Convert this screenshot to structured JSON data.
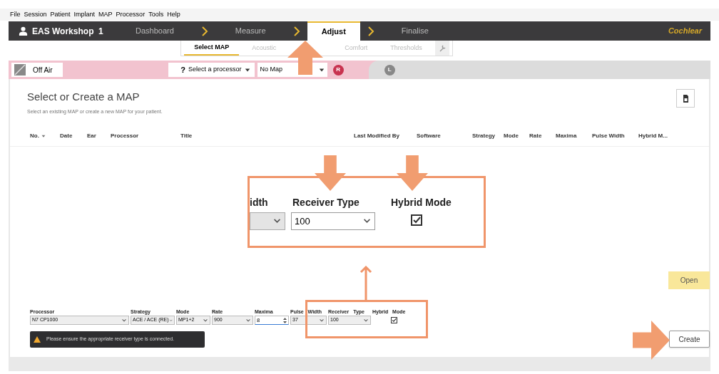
{
  "menu": [
    "File",
    "Session",
    "Patient",
    "Implant",
    "MAP",
    "Processor",
    "Tools",
    "Help"
  ],
  "nav": {
    "user": "EAS Workshop  1",
    "brand": "Cochlear",
    "steps": [
      {
        "label": "Dashboard",
        "selected": false
      },
      {
        "label": "Measure",
        "selected": false
      },
      {
        "label": "Adjust",
        "selected": true
      },
      {
        "label": "Finalise",
        "selected": false
      }
    ]
  },
  "subtabs": [
    {
      "label": "Select MAP",
      "selected": true
    },
    {
      "label": "Acoustic",
      "selected": false
    },
    {
      "label": "Comfort",
      "selected": false
    },
    {
      "label": "Thresholds",
      "selected": false
    }
  ],
  "status_bar": {
    "connection": "Off Air",
    "help_mark": "?",
    "processor_select": "Select a processor",
    "map_select": "No Map",
    "ears": [
      {
        "label": "R",
        "selected": true
      },
      {
        "label": "L",
        "selected": false
      }
    ]
  },
  "main": {
    "title": "Select or Create a MAP",
    "subtitle": "Select an existing MAP or create a new MAP for your patient.",
    "columns": [
      "No.",
      "Date",
      "Ear",
      "Processor",
      "Title",
      "Last Modified By",
      "Software",
      "Strategy",
      "Mode",
      "Rate",
      "Maxima",
      "Pulse Width",
      "Hybrid M..."
    ]
  },
  "callout": {
    "labels": [
      "idth",
      "Receiver Type",
      "Hybrid Mode"
    ],
    "receiver_value": "100",
    "hybrid_checked": true
  },
  "form": {
    "fields": [
      {
        "kind": "select",
        "label": "Processor",
        "value": "N7 CP1000"
      },
      {
        "kind": "select",
        "label": "Strategy",
        "value": "ACE / ACE (RE)"
      },
      {
        "kind": "select",
        "label": "Mode",
        "value": "MP1+2"
      },
      {
        "kind": "select",
        "label": "Rate",
        "value": "900"
      },
      {
        "kind": "spin",
        "label": "Maxima",
        "value": "8"
      },
      {
        "kind": "select",
        "label": "Pulse Width",
        "value": "37"
      },
      {
        "kind": "select",
        "label": "Receiver Type",
        "value": "100"
      },
      {
        "kind": "checkbox",
        "label": "Hybrid Mode",
        "checked": true
      }
    ],
    "warning": "Please ensure the appropriate receiver type is connected."
  },
  "buttons": {
    "open": "Open",
    "create": "Create"
  }
}
